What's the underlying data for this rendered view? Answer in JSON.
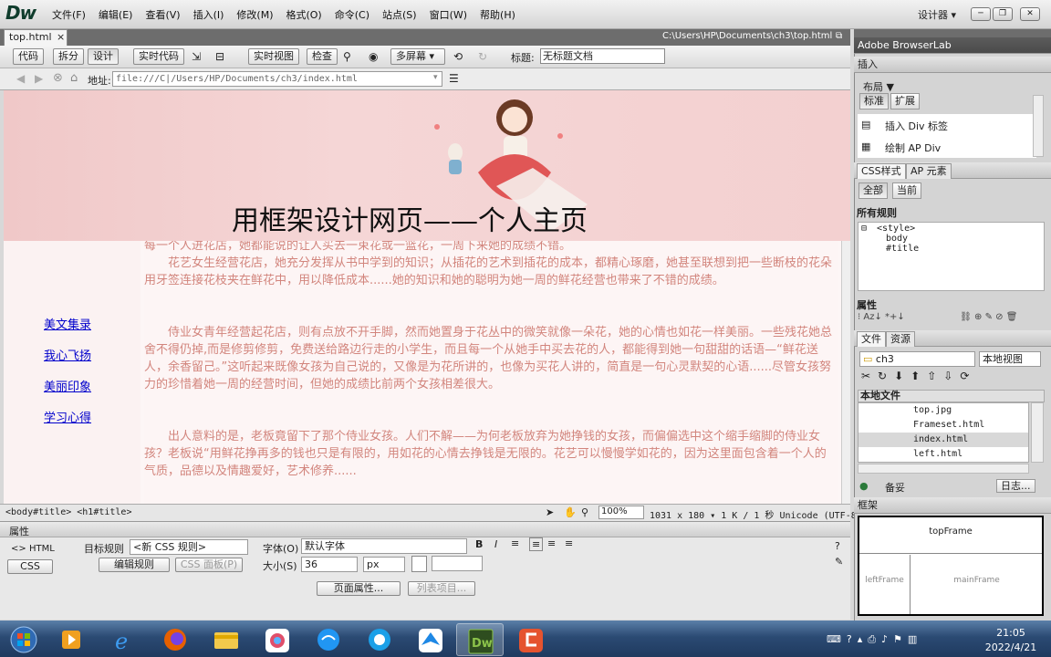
{
  "app": {
    "logo": "Dw",
    "workspace": "设计器 ▾"
  },
  "menu": [
    "文件(F)",
    "编辑(E)",
    "查看(V)",
    "插入(I)",
    "修改(M)",
    "格式(O)",
    "命令(C)",
    "站点(S)",
    "窗口(W)",
    "帮助(H)"
  ],
  "doc": {
    "tab": "top.html",
    "path": "C:\\Users\\HP\\Documents\\ch3\\top.html"
  },
  "toolbar": {
    "code": "代码",
    "split": "拆分",
    "design": "设计",
    "live_code": "实时代码",
    "live_view": "实时视图",
    "inspect": "检查",
    "multiscreen": "多屏幕",
    "title_label": "标题:",
    "title_value": "无标题文档"
  },
  "address": {
    "label": "地址:",
    "value": "file:///C|/Users/HP/Documents/ch3/index.html"
  },
  "page": {
    "banner_title": "用框架设计网页——个人主页",
    "nav": [
      "美文集录",
      "我心飞扬",
      "美丽印象",
      "学习心得"
    ],
    "paragraphs": [
      "每一个人进花店，她都能说的让人买去一束花或一篮花，一周下来她的成绩不错。",
      "花艺女生经营花店，她充分发挥从书中学到的知识；从插花的艺术到插花的成本，都精心琢磨，她甚至联想到把一些断枝的花朵用牙签连接花枝夹在鲜花中，用以降低成本......她的知识和她的聪明为她一周的鲜花经营也带来了不错的成绩。",
      "侍业女青年经营起花店，则有点放不开手脚，然而她置身于花丛中的微笑就像一朵花，她的心情也如花一样美丽。一些残花她总舍不得仍掉,而是修剪修剪，免费送给路边行走的小学生，而且每一个从她手中买去花的人，都能得到她一句甜甜的话语—“鲜花送人，余香留己。”这听起来既像女孩为自己说的，又像是为花所讲的，也像为买花人讲的，简直是一句心灵默契的心语......尽管女孩努力的珍惜着她一周的经营时间，但她的成绩比前两个女孩相差很大。",
      "出人意料的是，老板竟留下了那个侍业女孩。人们不解——为何老板放弃为她挣钱的女孩，而偏偏选中这个缩手缩脚的侍业女孩？老板说“用鲜花挣再多的钱也只是有限的，用如花的心情去挣钱是无限的。花艺可以慢慢学如花的，因为这里面包含着一个人的气质，品德以及情趣爱好，艺术修养......"
    ]
  },
  "status": {
    "tags": "<body#title> <h1#title>",
    "zoom": "100%",
    "dims": "1031 x 180 ▾  1 K / 1 秒  Unicode (UTF-8)"
  },
  "props": {
    "header": "属性",
    "html": "HTML",
    "css": "CSS",
    "target_rule_label": "目标规则",
    "target_rule_value": "<新 CSS 规则>",
    "edit_rule": "编辑规则",
    "css_panel": "CSS 面板(P)",
    "font_label": "字体(O)",
    "font_value": "默认字体",
    "size_label": "大小(S)",
    "size_value": "36",
    "unit_value": "px",
    "page_props": "页面属性...",
    "list_item": "列表项目..."
  },
  "right": {
    "browserlab": "Adobe BrowserLab",
    "insert": "插入",
    "layout": "布局 ▼",
    "tab_standard": "标准",
    "tab_extended": "扩展",
    "insert_div": "插入 Div 标签",
    "draw_ap": "绘制 AP Div",
    "css_styles": "CSS样式",
    "ap_elements": "AP 元素",
    "all": "全部",
    "current": "当前",
    "all_rules": "所有规则",
    "rules": [
      "<style>",
      "body",
      "#title"
    ],
    "properties": "属性",
    "files": "文件",
    "assets": "资源",
    "site": "ch3",
    "view": "本地视图",
    "local_files": "本地文件",
    "file_list": [
      "top.jpg",
      "Frameset.html",
      "index.html",
      "left.html"
    ],
    "ready": "备妥",
    "log": "日志...",
    "frames": "框架",
    "top_frame": "topFrame",
    "left_frame": "leftFrame",
    "main_frame": "mainFrame"
  },
  "clock": {
    "time": "21:05",
    "date": "2022/4/21"
  }
}
